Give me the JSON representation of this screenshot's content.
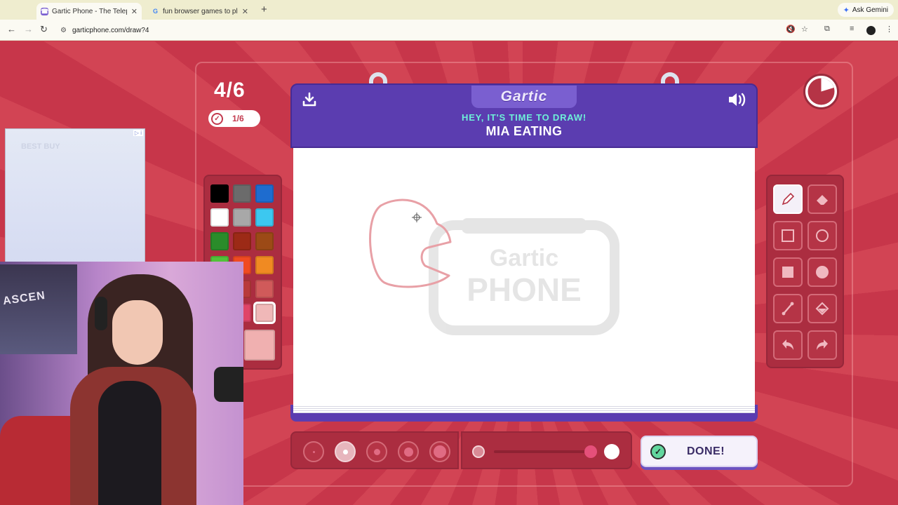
{
  "browser": {
    "tabs": [
      {
        "title": "Gartic Phone - The Telephone",
        "active": true,
        "favicon": "gartic-favicon"
      },
      {
        "title": "fun browser games to play w",
        "active": false,
        "favicon": "google-favicon"
      }
    ],
    "new_tab_label": "+",
    "gemini_label": "Ask Gemini",
    "url": "garticphone.com/draw?4"
  },
  "game": {
    "round": "4/6",
    "completed": "1/6",
    "logo": "Gartic",
    "subtitle": "HEY, IT'S TIME TO DRAW!",
    "prompt": "MIA EATING",
    "done_label": "DONE!",
    "palette_colors": [
      "#000000",
      "#6b6b6b",
      "#1e6ccf",
      "#ffffff",
      "#a8a8a8",
      "#3cc8f0",
      "#2a8c2a",
      "#9c2a16",
      "#9c4a16",
      "#52c23a",
      "#f04a22",
      "#f08a22",
      "#e04468",
      "#d05a5a",
      "#f0b8b8",
      "#f0b0b0"
    ],
    "selected_color": "#f0b0b0",
    "tools": [
      "pencil-icon",
      "eraser-icon",
      "rectangle-outline-icon",
      "circle-outline-icon",
      "rectangle-filled-icon",
      "circle-filled-icon",
      "line-icon",
      "fill-bucket-icon",
      "undo-icon",
      "redo-icon"
    ],
    "selected_tool": "pencil-icon",
    "brush_sizes": 5,
    "selected_brush_size": 2,
    "opacity_level": 0.9,
    "webcam_poster_text": "ASCEN"
  },
  "ad": {
    "badge": "▷ i",
    "logo": "BEST BUY"
  }
}
